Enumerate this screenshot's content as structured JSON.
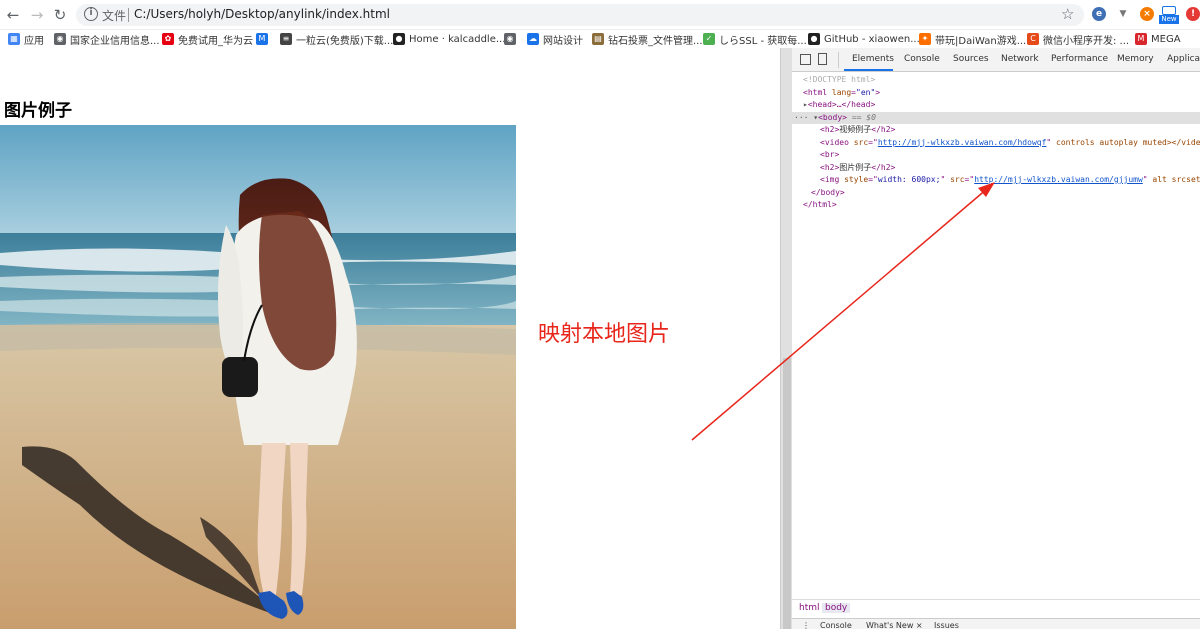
{
  "browser": {
    "scheme_label": "文件",
    "url": "C:/Users/holyh/Desktop/anylink/index.html",
    "ext_new_badge": "New"
  },
  "bookmarks": [
    {
      "label": "应用",
      "icon": "apps-grid-icon",
      "color": "#4285f4"
    },
    {
      "label": "国家企业信用信息...",
      "icon": "globe-icon",
      "color": "#5f6368"
    },
    {
      "label": "免费试用_华为云",
      "icon": "huawei-icon",
      "color": "#e60012"
    },
    {
      "label": "",
      "icon": "m-logo-icon",
      "color": "#1a73e8"
    },
    {
      "label": "一粒云(免费版)下载...",
      "icon": "doc-icon",
      "color": "#444444"
    },
    {
      "label": "Home · kalcaddle...",
      "icon": "github-icon",
      "color": "#222222"
    },
    {
      "label": "",
      "icon": "globe-icon",
      "color": "#5f6368"
    },
    {
      "label": "网站设计",
      "icon": "cloud-icon",
      "color": "#1a73e8"
    },
    {
      "label": "钻石投票_文件管理...",
      "icon": "folder-icon",
      "color": "#8b6d3b"
    },
    {
      "label": "しらSSL - 获取每...",
      "icon": "ssl-icon",
      "color": "#4caf50"
    },
    {
      "label": "GitHub - xiaowen...",
      "icon": "github-icon",
      "color": "#222222"
    },
    {
      "label": "带玩|DaiWan游戏...",
      "icon": "daiwan-icon",
      "color": "#ff6f00"
    },
    {
      "label": "微信小程序开发: ...",
      "icon": "c-logo-icon",
      "color": "#e64a19"
    },
    {
      "label": "MEGA",
      "icon": "mega-icon",
      "color": "#d9272e"
    }
  ],
  "page": {
    "title": "图片例子",
    "annotation": "映射本地图片"
  },
  "devtools": {
    "tabs": [
      "Elements",
      "Console",
      "Sources",
      "Network",
      "Performance",
      "Memory",
      "Application"
    ],
    "code": {
      "doctype": "<!DOCTYPE html>",
      "html_open": "<html lang=\"en\">",
      "head": "<head>…</head>",
      "body_open": "<body>",
      "body_marker": "== $0",
      "h2_video": "视频例子",
      "video_src": "http://mjj-wlkxzb.vaiwan.com/hdowqf",
      "video_tail": "controls autoplay muted></video>",
      "br": "<br>",
      "h2_img": "图片例子",
      "img_style": "width: 600px;",
      "img_src": "http://mjj-wlkxzb.vaiwan.com/gjjumw",
      "img_tail": "alt srcset",
      "body_close": "</body>",
      "html_close": "</html>"
    },
    "breadcrumbs": [
      "html",
      "body"
    ],
    "drawer_tabs": [
      "Console",
      "What's New ×",
      "Issues"
    ]
  }
}
